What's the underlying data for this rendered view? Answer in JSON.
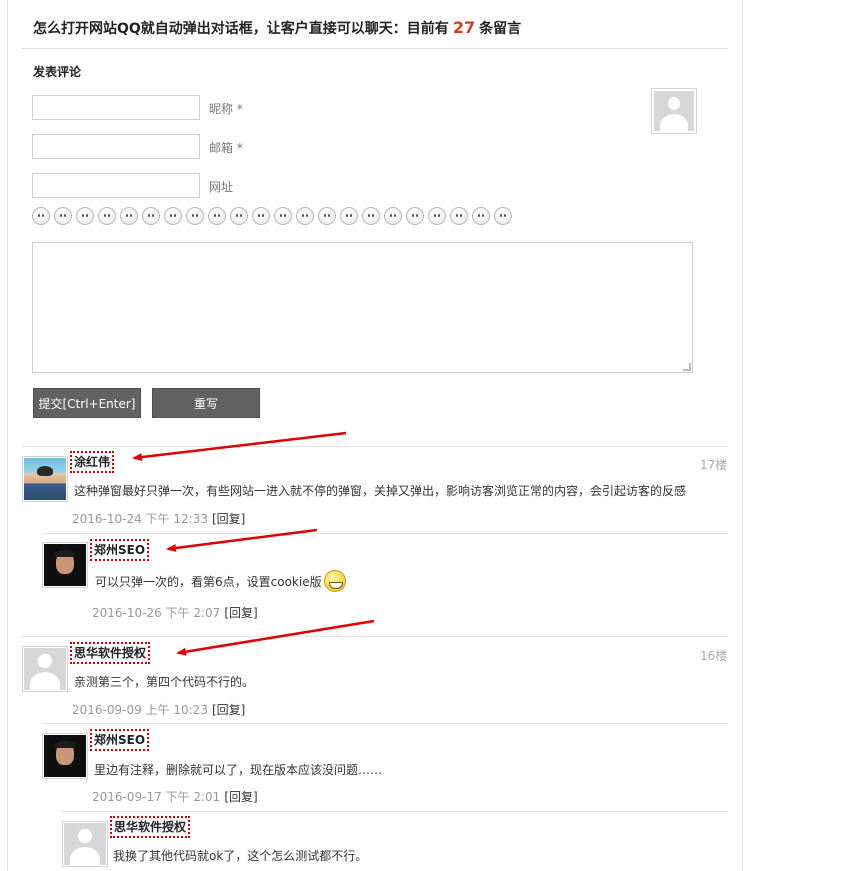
{
  "header": {
    "title_prefix": "怎么打开网站QQ就自动弹出对话框，让客户直接可以聊天：目前有",
    "comment_count": "27",
    "title_suffix": "条留言"
  },
  "form": {
    "title": "发表评论",
    "nickname_label": "昵称 *",
    "email_label": "邮箱 *",
    "website_label": "网址",
    "submit_label": "提交[Ctrl+Enter]",
    "reset_label": "重写"
  },
  "emojis": [
    "emoji-question",
    "emoji-smile",
    "emoji-tongue",
    "emoji-devil",
    "emoji-angry",
    "emoji-neutral",
    "emoji-sleepy",
    "emoji-sad",
    "emoji-cry",
    "emoji-shock",
    "emoji-surprised",
    "emoji-cool",
    "emoji-laugh",
    "emoji-dizzy",
    "emoji-pout",
    "emoji-grin",
    "emoji-wink",
    "emoji-love",
    "emoji-smirk",
    "emoji-shy",
    "emoji-tears",
    "emoji-silly"
  ],
  "comments": [
    {
      "author": "涂红伟",
      "floor": "17楼",
      "text": "这种弹窗最好只弹一次，有些网站一进入就不停的弹窗，关掉又弹出，影响访客浏览正常的内容，会引起访客的反感",
      "time": "2016-10-24 下午 12:33",
      "reply_label": "[回复]",
      "replies": [
        {
          "author": "郑州SEO",
          "text": "可以只弹一次的，看第6点，设置cookie版",
          "time": "2016-10-26 下午 2:07",
          "reply_label": "[回复]"
        }
      ]
    },
    {
      "author": "思华软件授权",
      "floor": "16楼",
      "text": "亲测第三个，第四个代码不行的。",
      "time": "2016-09-09 上午 10:23",
      "reply_label": "[回复]",
      "replies": [
        {
          "author": "郑州SEO",
          "text": "里边有注释，删除就可以了，现在版本应该没问题……",
          "time": "2016-09-17 下午 2:01",
          "reply_label": "[回复]",
          "replies": [
            {
              "author": "思华软件授权",
              "text": "我换了其他代码就ok了，这个怎么测试都不行。"
            }
          ]
        }
      ]
    }
  ],
  "colors": {
    "accent": "#c8441e",
    "annotation_red": "#c40000",
    "button_bg": "#626262"
  }
}
